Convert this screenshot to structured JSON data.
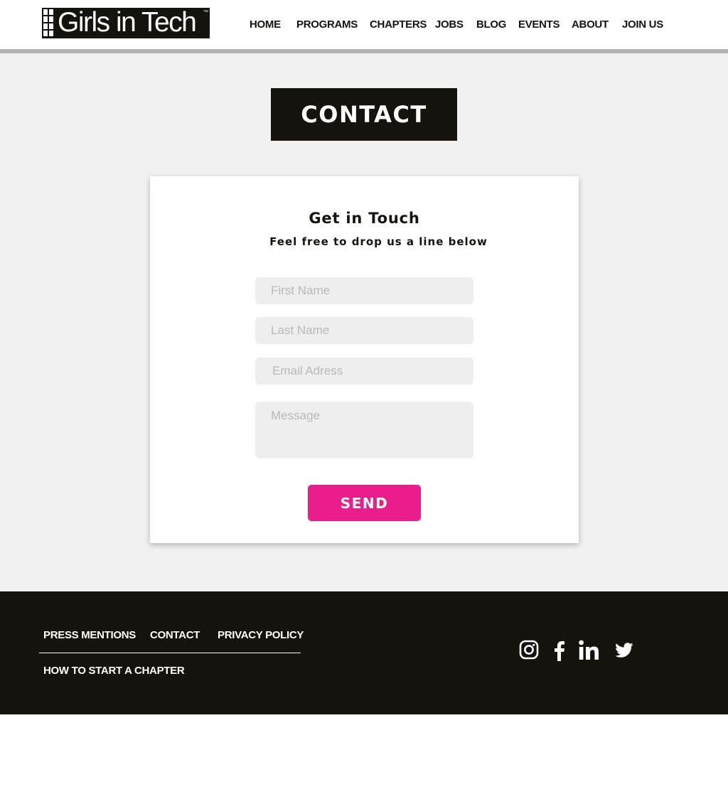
{
  "header": {
    "logo_text": "Girls in Tech",
    "logo_tm": "™",
    "nav": [
      {
        "label": "HOME"
      },
      {
        "label": "PROGRAMS"
      },
      {
        "label": "CHAPTERS"
      },
      {
        "label": "JOBS"
      },
      {
        "label": "BLOG"
      },
      {
        "label": "EVENTS"
      },
      {
        "label": "ABOUT"
      },
      {
        "label": "JOIN US"
      }
    ]
  },
  "main": {
    "title": "CONTACT",
    "card": {
      "heading": "Get in Touch",
      "subheading": "Feel free to drop us a line below",
      "fields": {
        "first_name_placeholder": "First Name",
        "last_name_placeholder": "Last Name",
        "email_placeholder": "Email Adress",
        "message_placeholder": "Message"
      },
      "send_label": "SEND"
    }
  },
  "footer": {
    "links": [
      {
        "label": "PRESS MENTIONS"
      },
      {
        "label": "CONTACT"
      },
      {
        "label": "PRIVACY POLICY"
      },
      {
        "label": "HOW TO START A CHAPTER"
      }
    ],
    "social": [
      "instagram-icon",
      "facebook-icon",
      "linkedin-icon",
      "twitter-icon"
    ]
  },
  "colors": {
    "dark": "#16130e",
    "accent": "#e91e8c",
    "background": "#f1f1f1",
    "input": "#eeeeee"
  }
}
